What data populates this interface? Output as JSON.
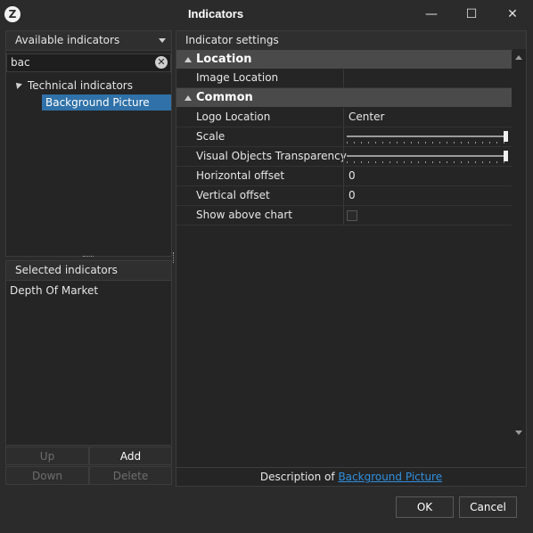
{
  "window": {
    "title": "Indicators",
    "logo_glyph": "Z",
    "minimize_glyph": "—",
    "maximize_glyph": "☐",
    "close_glyph": "✕"
  },
  "available": {
    "header": "Available indicators",
    "search_value": "bac",
    "clear_glyph": "✕",
    "tree": {
      "group_label": "Technical indicators",
      "selected_item": "Background Picture"
    }
  },
  "selected": {
    "header": "Selected indicators",
    "items": [
      "Depth Of Market"
    ]
  },
  "buttons": {
    "up": "Up",
    "add": "Add",
    "down": "Down",
    "delete": "Delete"
  },
  "settings": {
    "header": "Indicator settings",
    "groups": [
      {
        "label": "Location",
        "props": [
          {
            "name": "Image Location",
            "value": ""
          }
        ]
      },
      {
        "label": "Common",
        "props": [
          {
            "name": "Logo Location",
            "value": "Center"
          },
          {
            "name": "Scale",
            "value": 1.0
          },
          {
            "name": "Visual Objects Transparency",
            "value": 1.0
          },
          {
            "name": "Horizontal offset",
            "value": "0"
          },
          {
            "name": "Vertical offset",
            "value": "0"
          },
          {
            "name": "Show above chart",
            "value": false
          }
        ]
      }
    ]
  },
  "description": {
    "prefix": "Description of ",
    "link": "Background Picture"
  },
  "dialog": {
    "ok": "OK",
    "cancel": "Cancel"
  },
  "colors": {
    "background": "#2b2b2b",
    "selection": "#2f71a8",
    "group_row": "#4a4a4a",
    "link": "#2f8fe0"
  }
}
